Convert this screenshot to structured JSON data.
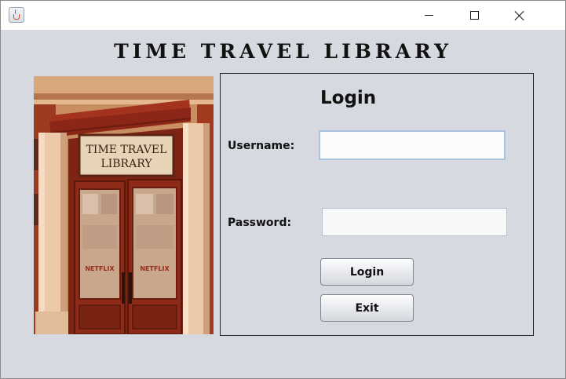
{
  "window": {
    "title_bar": {
      "app_icon": "java-cup-icon",
      "minimize_icon": "minimize-icon",
      "maximize_icon": "maximize-icon",
      "close_icon": "close-icon"
    }
  },
  "header": {
    "title": "TIME TRAVEL LIBRARY"
  },
  "photo": {
    "sign_line1": "TIME TRAVEL",
    "sign_line2": "LIBRARY",
    "door_text_left": "NETFLIX",
    "door_text_right": "NETFLIX"
  },
  "login": {
    "title": "Login",
    "username_label": "Username:",
    "username_value": "",
    "password_label": "Password:",
    "password_value": "",
    "login_button": "Login",
    "exit_button": "Exit"
  },
  "colors": {
    "background": "#d6d9e0",
    "door_red": "#8a2a18",
    "awning_red": "#a3321f",
    "pillar": "#e9c3a2"
  }
}
